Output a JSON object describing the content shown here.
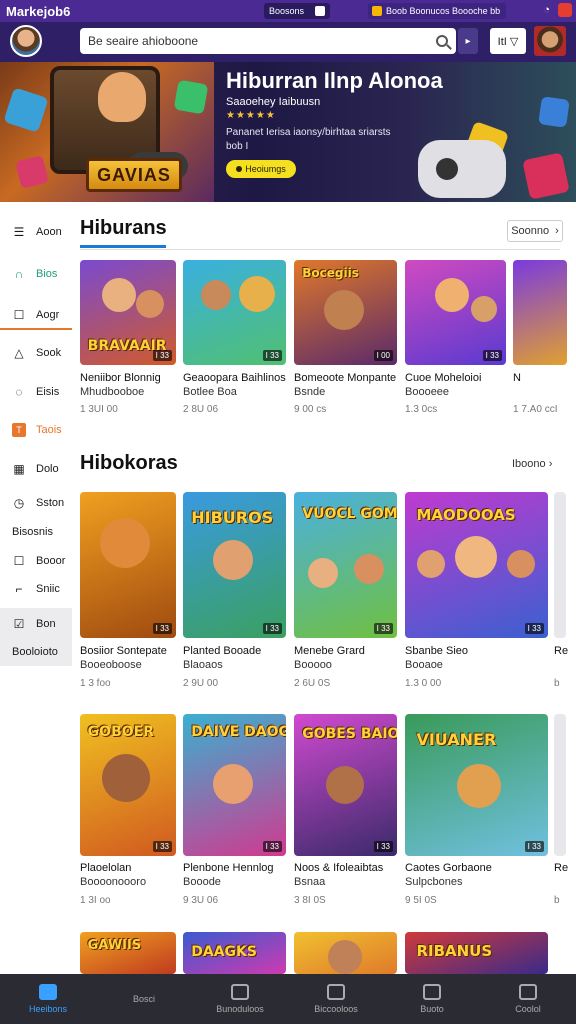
{
  "status_bar": {
    "app_name": "Markejob6",
    "pill_label": "Boosons",
    "notification": "Boob Boonucos Boooche bb",
    "colors": {
      "background": "#4b2a93"
    }
  },
  "header": {
    "search_placeholder": "Be seaire ahioboone",
    "cart_label": "ItI ▽",
    "colors": {
      "background": "#2f1f66"
    }
  },
  "banner": {
    "title": "Hiburran Ilnp Alonoa",
    "subtitle": "Saaoehey Iaibuusn",
    "stars": "★★★★★",
    "description": "Pananet Ierisa iaonsy/birhtaa sriarsts bob I",
    "cta_label": "Heoiumgs",
    "art_sign": "GAVIAS"
  },
  "sidebar": {
    "items": [
      {
        "label": "Aoon",
        "icon": "menu-icon"
      },
      {
        "label": "Bios",
        "icon": "headset-icon"
      },
      {
        "label": "Aogr",
        "icon": "square-icon"
      },
      {
        "label": "Sook",
        "icon": "triangle-icon"
      },
      {
        "label": "Eisis",
        "icon": "circle-icon"
      },
      {
        "label": "Taois",
        "icon": "tag-icon"
      },
      {
        "label": "Dolo",
        "icon": "grid-icon"
      },
      {
        "label": "Sston",
        "icon": "clock-icon"
      },
      {
        "label": "Bisosnis",
        "icon": ""
      },
      {
        "label": "Booor",
        "icon": "checkbox-icon"
      },
      {
        "label": "Sniic",
        "icon": "corner-icon"
      },
      {
        "label": "Bon",
        "icon": "edit-icon"
      },
      {
        "label": "Booloioto",
        "icon": ""
      }
    ]
  },
  "section1": {
    "title": "Hiburans",
    "see_all": "Soonno",
    "cards": [
      {
        "line1": "Neniibor Blonnig",
        "line2": "Mhudbooboe",
        "meta": "1 3UI 00",
        "count": "I 33",
        "logo": "BRAVAAIR"
      },
      {
        "line1": "Geaoopara Baihlinos",
        "line2": "Botlee Boa",
        "meta": "2 8U 06",
        "count": "I 33",
        "logo": ""
      },
      {
        "line1": "Bomeoote Monpante",
        "line2": "Bsnde",
        "meta": "9 00 cs",
        "count": "I 00",
        "logo": "Bocegiis"
      },
      {
        "line1": "Cuoe Moheloioi",
        "line2": "Boooeee",
        "meta": "1.3 0cs",
        "count": "I 33",
        "logo": ""
      },
      {
        "line1": "N",
        "line2": "",
        "meta": "1 7.A0 ccI",
        "count": "",
        "logo": ""
      }
    ]
  },
  "section2": {
    "title": "Hibokoras",
    "see_more": "Iboono",
    "row1": [
      {
        "line1": "Bosiior Sontepate",
        "line2": "Booeoboose",
        "meta": "1 3 foo",
        "count": "I 33",
        "logo": ""
      },
      {
        "line1": "Planted Booade",
        "line2": "Blaoaos",
        "meta": "2 9U 00",
        "count": "I 33",
        "logo": "HIBUROS"
      },
      {
        "line1": "Menebe Grard",
        "line2": "Booooo",
        "meta": "2 6U 0S",
        "count": "I 33",
        "logo": "VUOCL GOMES"
      },
      {
        "line1": "Sbanbe Sieo",
        "line2": "Booaoe",
        "meta": "1.3 0 00",
        "count": "I 33",
        "logo": "MAODOOAS"
      }
    ],
    "row2": [
      {
        "line1": "Plaoelolan",
        "line2": "Boooonoooro",
        "meta": "1 3I oo",
        "count": "I 33",
        "logo": "GOBOER"
      },
      {
        "line1": "Plenbone Hennlog",
        "line2": "Booode",
        "meta": "9 3U 06",
        "count": "I 33",
        "logo": "DAIVE DAOGES"
      },
      {
        "line1": "Noos & Ifoleaibtas",
        "line2": "Bsnaa",
        "meta": "3 8I 0S",
        "count": "I 33",
        "logo": "GOBES BAIOS"
      },
      {
        "line1": "Caotes Gorbaone",
        "line2": "Sulpcbones",
        "meta": "9 5I 0S",
        "count": "I 33",
        "logo": "VIUANER"
      }
    ],
    "row3": [
      {
        "logo": "GAWIIS"
      },
      {
        "logo": "DAAGKS"
      },
      {
        "logo": ""
      },
      {
        "logo": "RIBANUS"
      }
    ],
    "partial": [
      {
        "line1": "Re",
        "line2": "",
        "meta": "b"
      },
      {
        "line1": "Re",
        "line2": "",
        "meta": "b"
      }
    ]
  },
  "bottom_nav": {
    "items": [
      {
        "label": "Heeibons",
        "icon": "home-icon"
      },
      {
        "label": "Bosci",
        "icon": ""
      },
      {
        "label": "Bunoduloos",
        "icon": "house-icon"
      },
      {
        "label": "Biccooloos",
        "icon": "square-icon"
      },
      {
        "label": "Buoto",
        "icon": "inbox-icon"
      },
      {
        "label": "Coolol",
        "icon": "pin-icon"
      }
    ],
    "colors": {
      "background": "#2b2b33",
      "active": "#3aa0ff"
    }
  }
}
